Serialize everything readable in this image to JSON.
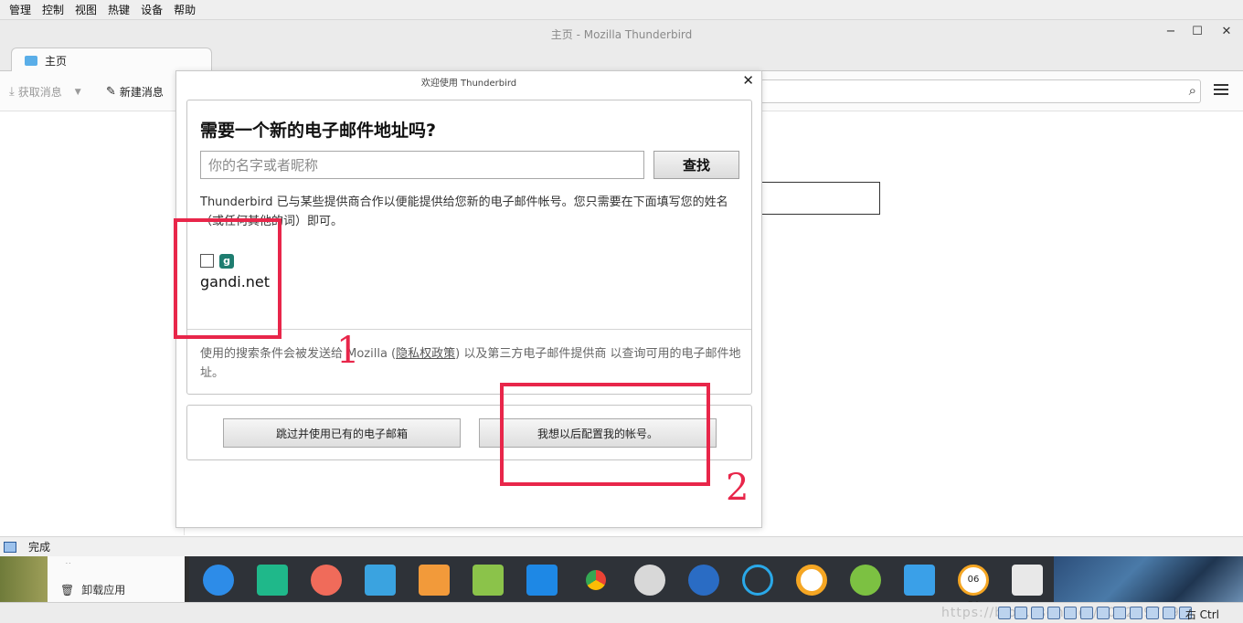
{
  "host_menu": [
    "管理",
    "控制",
    "视图",
    "热键",
    "设备",
    "帮助"
  ],
  "window": {
    "title": "主页 - Mozilla Thunderbird",
    "controls": [
      "−",
      "☐",
      "✕"
    ]
  },
  "tabs": [
    {
      "label": "主页"
    }
  ],
  "toolbar": {
    "get_messages": "获取消息",
    "new_message": "新建消息"
  },
  "dialog": {
    "title": "欢迎使用 Thunderbird",
    "heading": "需要一个新的电子邮件地址吗?",
    "name_placeholder": "你的名字或者昵称",
    "find_button": "查找",
    "description": "Thunderbird 已与某些提供商合作以便能提供给您新的电子邮件帐号。您只需要在下面填写您的姓名（或任何其他的词）即可。",
    "provider_logo_letter": "g",
    "provider": "gandi.net",
    "footnote_before": "使用的搜索条件会被发送给 Mozilla (",
    "footnote_link": "隐私权政策",
    "footnote_after": ") 以及第三方电子邮件提供商 以查询可用的电子邮件地址。",
    "skip_button": "跳过并使用已有的电子邮箱",
    "later_button": "我想以后配置我的帐号。"
  },
  "annotations": {
    "one": "1",
    "two": "2"
  },
  "statusbar": {
    "text": "完成"
  },
  "desktop": {
    "uninstall": "卸载应用",
    "uninstall_icon": "🗑",
    "clock_text": "06 54"
  },
  "vbox_status": {
    "watermark": "https://blog.csdn.net/u012997698",
    "host_key": "右 Ctrl"
  },
  "colors": {
    "annotation": "#e8264a",
    "dock": "#2e3238"
  }
}
